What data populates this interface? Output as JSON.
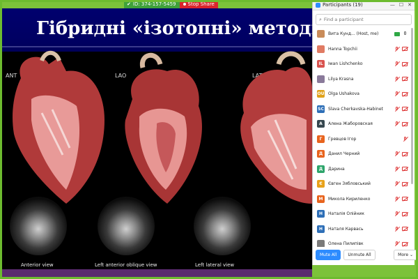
{
  "share_bar": {
    "meeting_id": "ID: 374-157-5459",
    "stop_label": "Stop Share"
  },
  "slide": {
    "title": "Гібридні «ізотопні» методики",
    "views": [
      "ANT",
      "LAO",
      "LAT"
    ],
    "captions": [
      "Anterior view",
      "Left anterior oblique view",
      "Left lateral view"
    ]
  },
  "participants": {
    "header": "Participants (19)",
    "search_placeholder": "Find a participant",
    "items": [
      {
        "initial": "",
        "name": "Вита Кунд... (Host, me)",
        "color": "#c98c5a",
        "mic": "on",
        "video": "on"
      },
      {
        "initial": "",
        "name": "Hanna Topchii",
        "color": "#e07b63",
        "mic": "off",
        "video": "off"
      },
      {
        "initial": "IL",
        "name": "Iwan Lishchenko",
        "color": "#d9534f",
        "mic": "off",
        "video": "off"
      },
      {
        "initial": "",
        "name": "Lilya  Krasna",
        "color": "#8a7a9a",
        "mic": "off",
        "video": "off"
      },
      {
        "initial": "OU",
        "name": "Olga Ushakova",
        "color": "#e0a21b",
        "mic": "off",
        "video": "off"
      },
      {
        "initial": "SC",
        "name": "Slava Cherkavska-Habinet",
        "color": "#2e6fb7",
        "mic": "off",
        "video": "off"
      },
      {
        "initial": "А",
        "name": "Алена Жаборовская",
        "color": "#37474f",
        "mic": "off",
        "video": "off"
      },
      {
        "initial": "Г",
        "name": "Гревцов Ігор",
        "color": "#e8641e",
        "mic": "off",
        "video": "none"
      },
      {
        "initial": "Д",
        "name": "Данил Черний",
        "color": "#e8641e",
        "mic": "off",
        "video": "off"
      },
      {
        "initial": "Д",
        "name": "Дарина",
        "color": "#2ea56b",
        "mic": "off",
        "video": "off"
      },
      {
        "initial": "Є",
        "name": "Євген Зябловський",
        "color": "#e8a21b",
        "mic": "off",
        "video": "off"
      },
      {
        "initial": "М",
        "name": "Микола Кириленко",
        "color": "#e8641e",
        "mic": "off",
        "video": "off"
      },
      {
        "initial": "Н",
        "name": "Наталія Олійник",
        "color": "#2e6fb7",
        "mic": "off",
        "video": "off"
      },
      {
        "initial": "Н",
        "name": "Наталя Карвась",
        "color": "#2e6fb7",
        "mic": "off",
        "video": "off"
      },
      {
        "initial": "",
        "name": "Олена Пилипівк",
        "color": "#7a7a7a",
        "mic": "off",
        "video": "off"
      }
    ],
    "mute_all": "Mute All",
    "unmute_all": "Unmute All",
    "more": "More"
  }
}
